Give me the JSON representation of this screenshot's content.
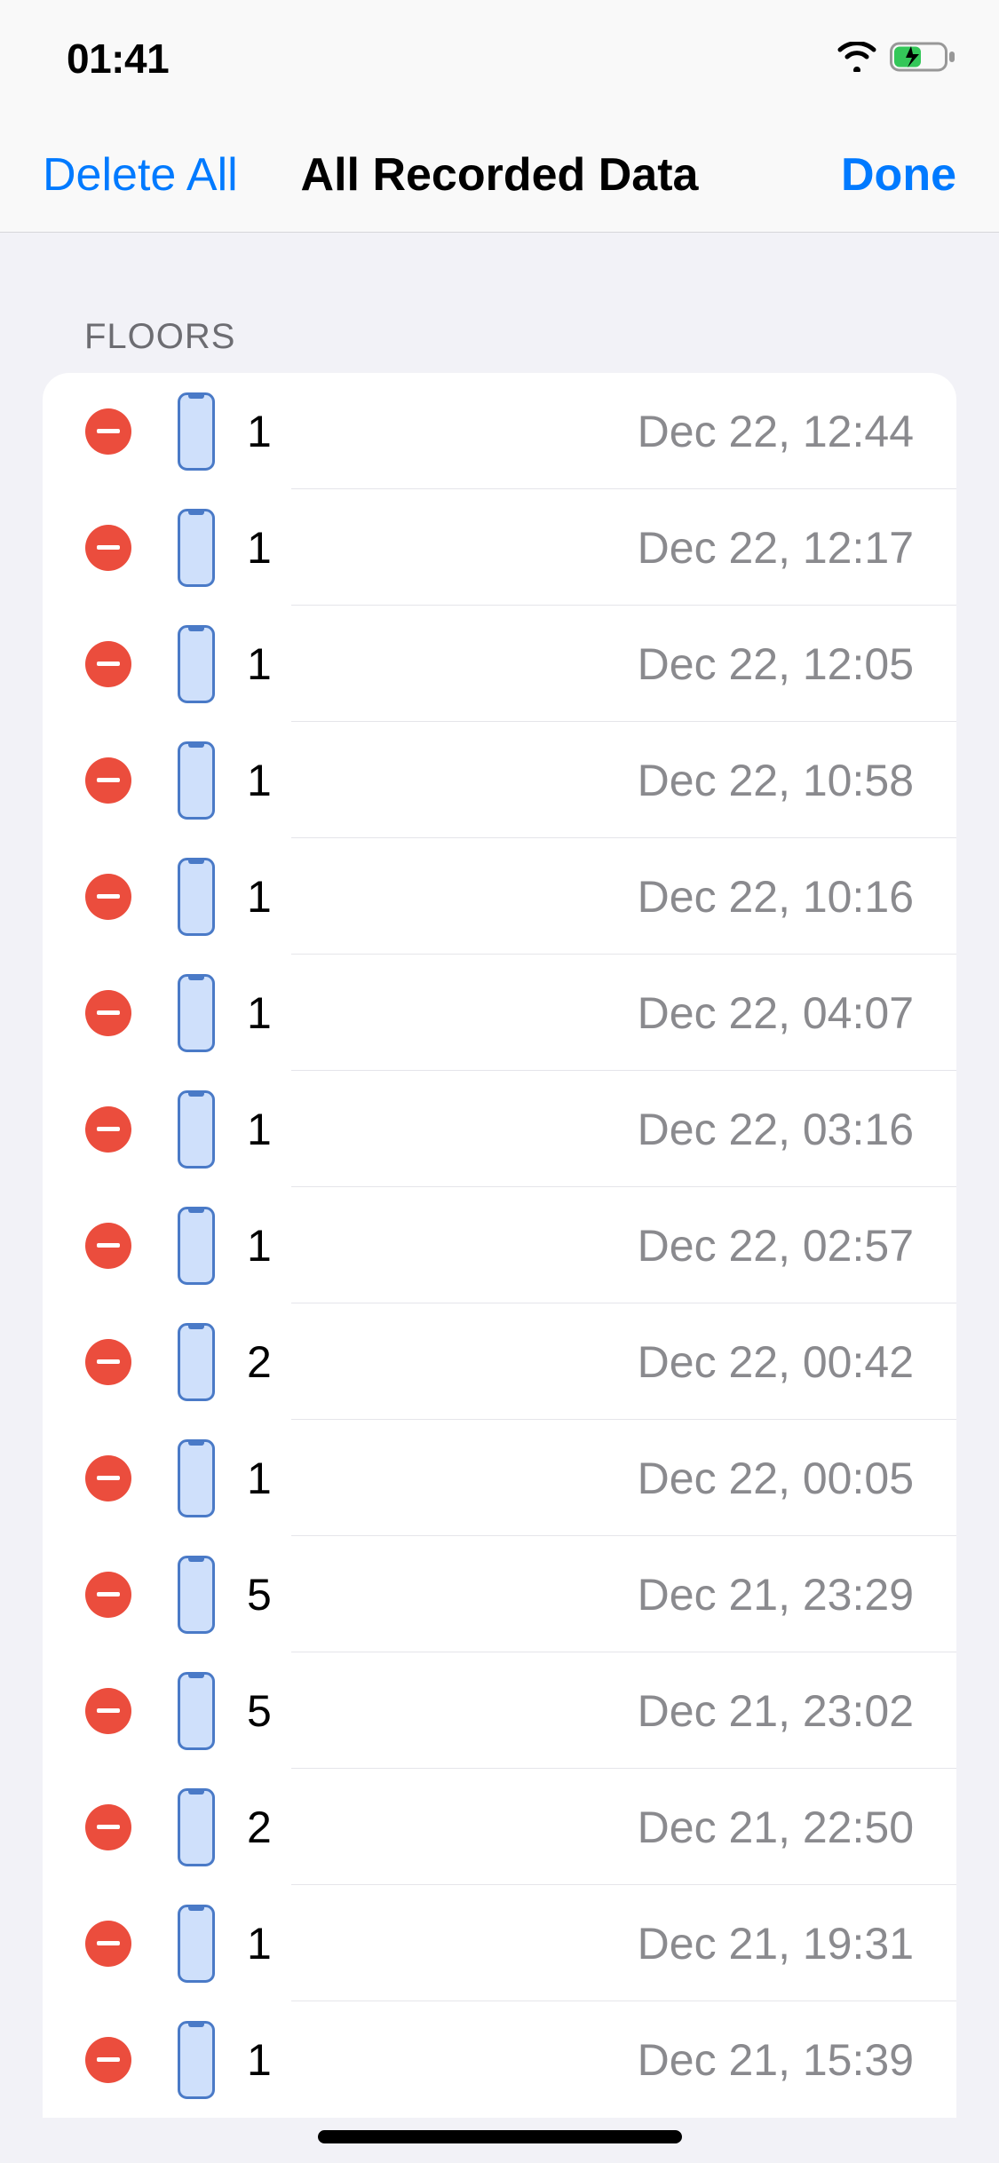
{
  "status": {
    "time": "01:41"
  },
  "nav": {
    "left_label": "Delete All",
    "title": "All Recorded Data",
    "right_label": "Done"
  },
  "section_header": "FLOORS",
  "rows": [
    {
      "value": "1",
      "date": "Dec 22, 12:44"
    },
    {
      "value": "1",
      "date": "Dec 22, 12:17"
    },
    {
      "value": "1",
      "date": "Dec 22, 12:05"
    },
    {
      "value": "1",
      "date": "Dec 22, 10:58"
    },
    {
      "value": "1",
      "date": "Dec 22, 10:16"
    },
    {
      "value": "1",
      "date": "Dec 22, 04:07"
    },
    {
      "value": "1",
      "date": "Dec 22, 03:16"
    },
    {
      "value": "1",
      "date": "Dec 22, 02:57"
    },
    {
      "value": "2",
      "date": "Dec 22, 00:42"
    },
    {
      "value": "1",
      "date": "Dec 22, 00:05"
    },
    {
      "value": "5",
      "date": "Dec 21, 23:29"
    },
    {
      "value": "5",
      "date": "Dec 21, 23:02"
    },
    {
      "value": "2",
      "date": "Dec 21, 22:50"
    },
    {
      "value": "1",
      "date": "Dec 21, 19:31"
    },
    {
      "value": "1",
      "date": "Dec 21, 15:39"
    }
  ]
}
